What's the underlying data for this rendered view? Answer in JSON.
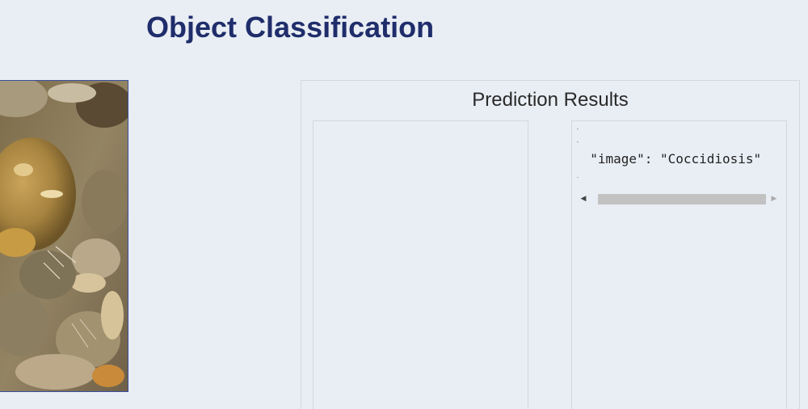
{
  "header": {
    "title": "Object Classification"
  },
  "image_panel": {
    "icon": "uploaded-image"
  },
  "results": {
    "title": "Prediction Results",
    "json_output": {
      "open_brace": "-",
      "key_line_prefix": "-",
      "line": "  \"image\": \"Coccidiosis\"",
      "close_brace": "-"
    },
    "scrollbar": {
      "left_arrow": "◀",
      "right_arrow": "▶"
    }
  },
  "colors": {
    "title": "#1f2d6b",
    "background": "#e9eef4",
    "panel_border": "#d3d8de",
    "image_border": "#3a4fa0"
  }
}
